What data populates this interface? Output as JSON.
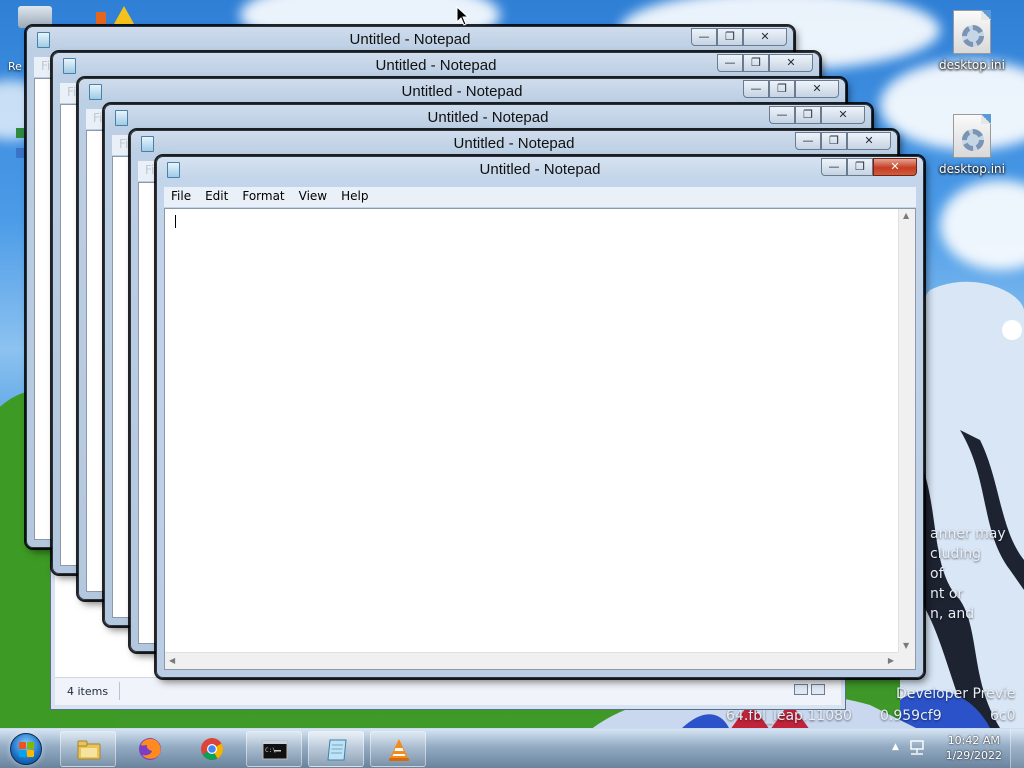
{
  "desktop": {
    "icons": [
      {
        "label": "desktop.ini"
      },
      {
        "label": "desktop.ini"
      }
    ],
    "left_fragments": [
      "Re"
    ],
    "bg_text_lines": [
      "anner may",
      "cluding",
      "of",
      "nt or",
      "n, and",
      "Developer Previe",
      "64.fbl_leap.11080",
      "0.959cf9",
      "6c0"
    ]
  },
  "explorer": {
    "status_text": "4 items"
  },
  "notepad": {
    "title": "Untitled - Notepad",
    "menu": [
      "File",
      "Edit",
      "Format",
      "View",
      "Help"
    ],
    "controls": {
      "minimize": "—",
      "maximize": "❐",
      "close": "✕"
    },
    "background_window_count": 5
  },
  "taskbar": {
    "apps": [
      {
        "name": "Windows Explorer",
        "icon": "folder-icon"
      },
      {
        "name": "Firefox",
        "icon": "firefox-icon"
      },
      {
        "name": "Chrome",
        "icon": "chrome-icon"
      },
      {
        "name": "Command Prompt",
        "icon": "cmd-icon"
      },
      {
        "name": "Notepad",
        "icon": "notepad-icon"
      },
      {
        "name": "VLC media player",
        "icon": "vlc-icon"
      }
    ],
    "clock": {
      "time": "10:42 AM",
      "date": "1/29/2022"
    }
  }
}
